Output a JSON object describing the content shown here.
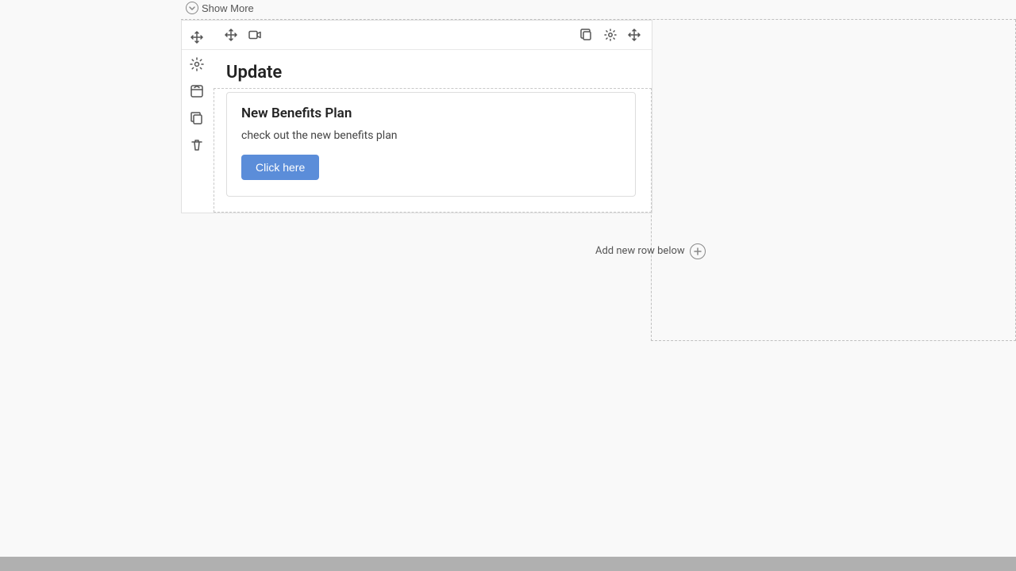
{
  "page": {
    "background": "#f9f9f9"
  },
  "show_more": {
    "label": "Show More"
  },
  "toolbar": {
    "icons": {
      "move": "move-icon",
      "video": "video-icon",
      "duplicate": "duplicate-icon",
      "settings": "settings-icon",
      "drag": "drag-icon"
    }
  },
  "sidebar": {
    "icons": [
      {
        "name": "move-sidebar-icon",
        "label": "Move"
      },
      {
        "name": "settings-sidebar-icon",
        "label": "Settings"
      },
      {
        "name": "collapse-sidebar-icon",
        "label": "Collapse"
      },
      {
        "name": "copy-sidebar-icon",
        "label": "Copy"
      },
      {
        "name": "delete-sidebar-icon",
        "label": "Delete"
      }
    ]
  },
  "block": {
    "title": "Update",
    "card": {
      "title": "New Benefits Plan",
      "description": "check out the new benefits plan",
      "button_label": "Click here"
    }
  },
  "add_row": {
    "label": "Add new row below"
  }
}
